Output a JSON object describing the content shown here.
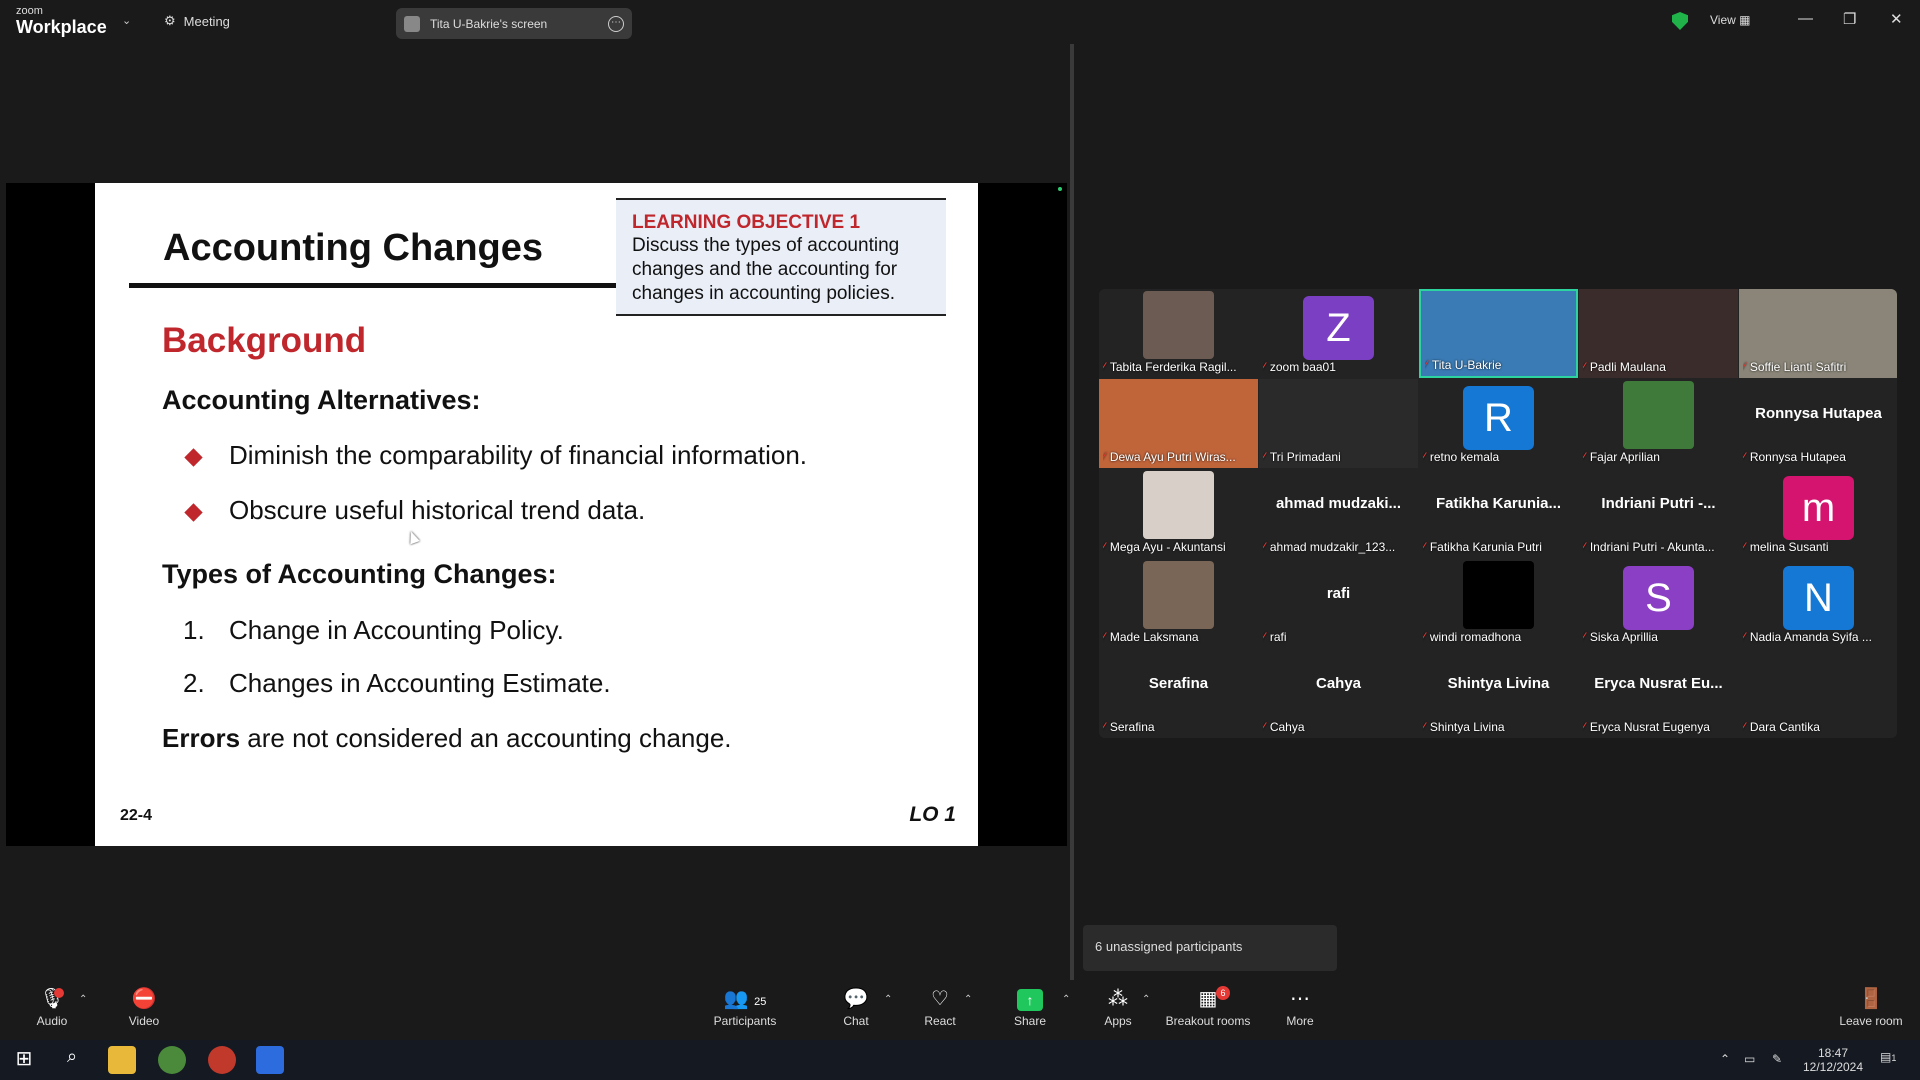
{
  "app": {
    "brand_small": "zoom",
    "brand_big": "Workplace",
    "meeting_label": "Meeting",
    "shared_screen_label": "Tita U-Bakrie's screen",
    "view_label": "View"
  },
  "slide": {
    "title": "Accounting Changes",
    "lo_head": "LEARNING OBJECTIVE 1",
    "lo_text": "Discuss the types of accounting changes and the accounting for changes in accounting policies.",
    "background": "Background",
    "alt_heading": "Accounting Alternatives:",
    "bullets": [
      "Diminish the comparability of financial information.",
      "Obscure useful historical trend data."
    ],
    "types_heading": "Types of Accounting Changes:",
    "types": [
      {
        "num": "1.",
        "text": "Change in Accounting Policy."
      },
      {
        "num": "2.",
        "text": "Changes in Accounting Estimate."
      }
    ],
    "errors_bold": "Errors",
    "errors_rest": " are not considered an accounting change.",
    "page": "22-4",
    "lo_tag": "LO 1"
  },
  "participants": [
    {
      "name": "Tabita Ferderika Ragil...",
      "kind": "photo",
      "color": "#6b5b52"
    },
    {
      "name": "zoom baa01",
      "kind": "avatar",
      "letter": "Z",
      "color": "#7b3fc4"
    },
    {
      "name": "Tita U-Bakrie",
      "kind": "video",
      "color": "#3a7bb5",
      "active": true
    },
    {
      "name": "Padli Maulana",
      "kind": "video",
      "color": "#3a2c2a"
    },
    {
      "name": "Soffie Lianti Safitri",
      "kind": "video",
      "color": "#8a8578"
    },
    {
      "name": "Dewa Ayu Putri Wiras...",
      "kind": "video",
      "color": "#c0643a"
    },
    {
      "name": "Tri Primadani",
      "kind": "video",
      "color": "#2a2a2a"
    },
    {
      "name": "retno kemala",
      "kind": "avatar",
      "letter": "R",
      "color": "#1478d4"
    },
    {
      "name": "Fajar Aprilian",
      "kind": "photo",
      "color": "#3f7a3a"
    },
    {
      "name": "Ronnysa Hutapea",
      "kind": "text",
      "big": "Ronnysa Hutapea"
    },
    {
      "name": "Mega Ayu - Akuntansi",
      "kind": "photo",
      "color": "#d8d0c8"
    },
    {
      "name": "ahmad mudzakir_123...",
      "kind": "text",
      "big": "ahmad mudzaki..."
    },
    {
      "name": "Fatikha Karunia Putri",
      "kind": "text",
      "big": "Fatikha Karunia..."
    },
    {
      "name": "Indriani Putri - Akunta...",
      "kind": "text",
      "big": "Indriani Putri -..."
    },
    {
      "name": "melina Susanti",
      "kind": "avatar",
      "letter": "m",
      "color": "#d4146e"
    },
    {
      "name": "Made Laksmana",
      "kind": "photo",
      "color": "#7a6656"
    },
    {
      "name": "rafi",
      "kind": "text",
      "big": "rafi"
    },
    {
      "name": "windi romadhona",
      "kind": "photo",
      "color": "#000000"
    },
    {
      "name": "Siska Aprillia",
      "kind": "avatar",
      "letter": "S",
      "color": "#8a3fc4"
    },
    {
      "name": "Nadia Amanda Syifa ...",
      "kind": "avatar",
      "letter": "N",
      "color": "#1478d4"
    },
    {
      "name": "Serafina",
      "kind": "text",
      "big": "Serafina"
    },
    {
      "name": "Cahya",
      "kind": "text",
      "big": "Cahya"
    },
    {
      "name": "Shintya Livina",
      "kind": "text",
      "big": "Shintya Livina"
    },
    {
      "name": "Eryca Nusrat Eugenya",
      "kind": "text",
      "big": "Eryca Nusrat Eu..."
    },
    {
      "name": "Dara Cantika",
      "kind": "none"
    }
  ],
  "unassigned": "6 unassigned participants",
  "toolbar": {
    "audio": "Audio",
    "video": "Video",
    "participants": "Participants",
    "participants_count": "25",
    "chat": "Chat",
    "react": "React",
    "share": "Share",
    "apps": "Apps",
    "breakout": "Breakout rooms",
    "breakout_badge": "6",
    "more": "More",
    "leave": "Leave room"
  },
  "taskbar": {
    "time": "18:47",
    "date": "12/12/2024",
    "notif": "1"
  }
}
